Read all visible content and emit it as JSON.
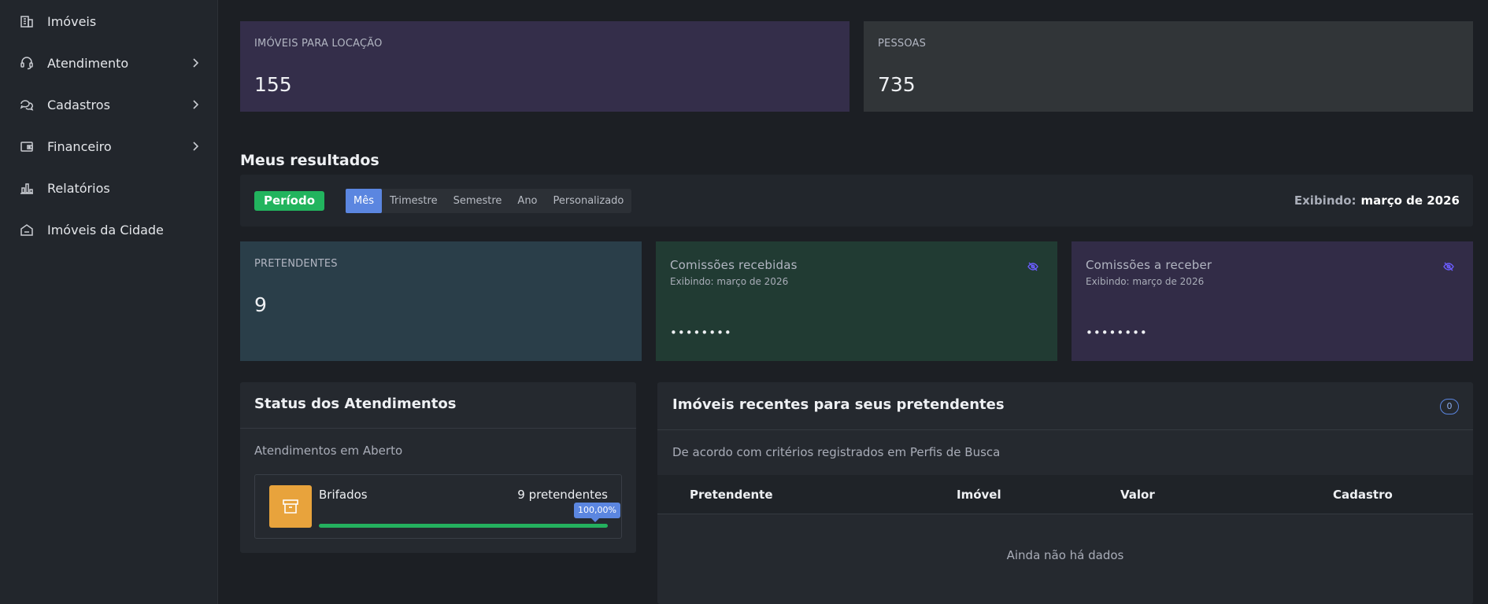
{
  "sidebar": {
    "items": [
      {
        "label": "Imóveis",
        "icon": "building-icon",
        "has_submenu": false
      },
      {
        "label": "Atendimento",
        "icon": "headset-icon",
        "has_submenu": true
      },
      {
        "label": "Cadastros",
        "icon": "chat-bubbles-icon",
        "has_submenu": true
      },
      {
        "label": "Financeiro",
        "icon": "wallet-icon",
        "has_submenu": true
      },
      {
        "label": "Relatórios",
        "icon": "bar-chart-icon",
        "has_submenu": false
      },
      {
        "label": "Imóveis da Cidade",
        "icon": "home-icon",
        "has_submenu": false
      }
    ]
  },
  "top_cards": [
    {
      "title": "IMÓVEIS PARA LOCAÇÃO",
      "value": "155",
      "color": "#342e4a"
    },
    {
      "title": "PESSOAS",
      "value": "735",
      "color": "#313538"
    }
  ],
  "results": {
    "title": "Meus resultados",
    "period_label": "Período",
    "tabs": [
      "Mês",
      "Trimestre",
      "Semestre",
      "Ano",
      "Personalizado"
    ],
    "active_tab": "Mês",
    "showing_label": "Exibindo:",
    "showing_value": "março de 2026"
  },
  "metric_cards": [
    {
      "title": "PRETENDENTES",
      "value": "9",
      "color": "#2a3e49"
    },
    {
      "title": "Comissões recebidas",
      "subtitle": "Exibindo: março de 2026",
      "value": "••••••••",
      "color": "#213b33",
      "icon": "eye-off-icon"
    },
    {
      "title": "Comissões a receber",
      "subtitle": "Exibindo: março de 2026",
      "value": "••••••••",
      "color": "#322c47",
      "icon": "eye-off-icon"
    }
  ],
  "status_panel": {
    "title": "Status dos Atendimentos",
    "subtitle": "Atendimentos em Aberto",
    "item": {
      "label": "Brifados",
      "count": "9 pretendentes",
      "percent_label": "100,00%",
      "percent": 100,
      "icon": "archive-icon"
    }
  },
  "recent_panel": {
    "title": "Imóveis recentes para seus pretendentes",
    "count": "0",
    "subtitle": "De acordo com critérios registrados em Perfis de Busca",
    "columns": [
      "Pretendente",
      "Imóvel",
      "Valor",
      "Cadastro"
    ],
    "empty_text": "Ainda não há dados"
  },
  "colors": {
    "accent": "#5b86e0",
    "success": "#22b45e",
    "warning": "#e8a33c"
  }
}
